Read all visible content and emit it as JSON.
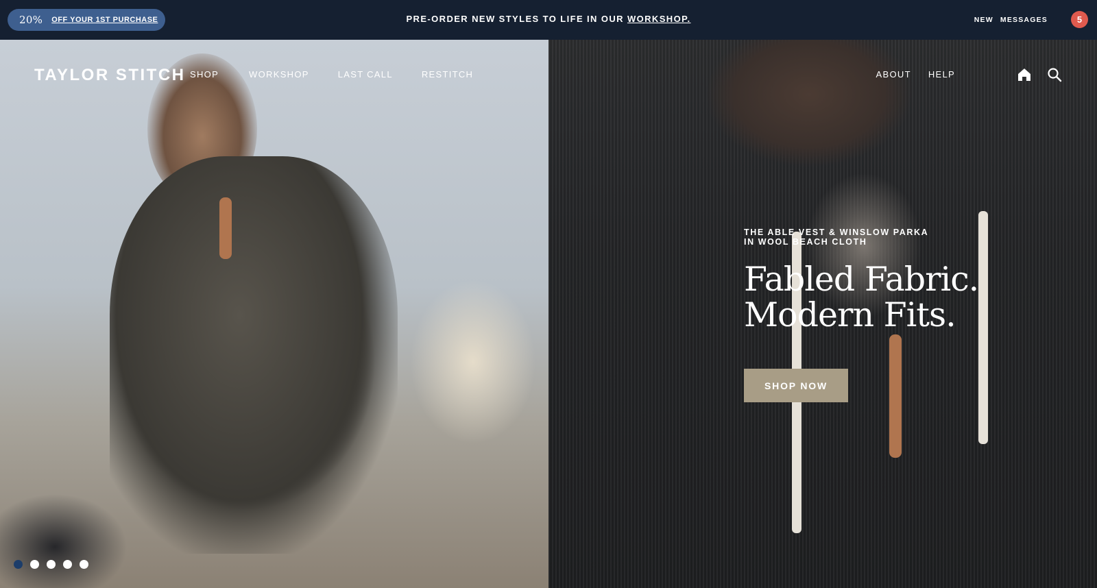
{
  "promo": {
    "discount_percent": "20%",
    "discount_label": "OFF YOUR 1ST PURCHASE",
    "message_prefix": "PRE-ORDER NEW STYLES TO LIFE IN OUR ",
    "message_link": "WORKSHOP.",
    "messages_new": "NEW",
    "messages_label": "MESSAGES",
    "messages_count": "5"
  },
  "nav": {
    "logo": "TAYLOR STITCH",
    "left_items": [
      {
        "label": "SHOP"
      },
      {
        "label": "WORKSHOP"
      },
      {
        "label": "LAST CALL"
      },
      {
        "label": "RESTITCH"
      }
    ],
    "right_items": [
      {
        "label": "ABOUT"
      },
      {
        "label": "HELP"
      }
    ],
    "icons": [
      "home-icon",
      "search-icon"
    ]
  },
  "hero": {
    "eyebrow": "THE ABLE VEST & WINSLOW PARKA\nIN WOOL BEACH CLOTH",
    "headline": "Fabled Fabric.\nModern Fits.",
    "cta_label": "SHOP NOW",
    "cta_color": "#a89d86"
  },
  "carousel": {
    "slide_count": 5,
    "active_index": 0
  },
  "colors": {
    "promo_bar": "#152031",
    "discount_pill": "#3e5f8f",
    "badge": "#e05a4e"
  }
}
